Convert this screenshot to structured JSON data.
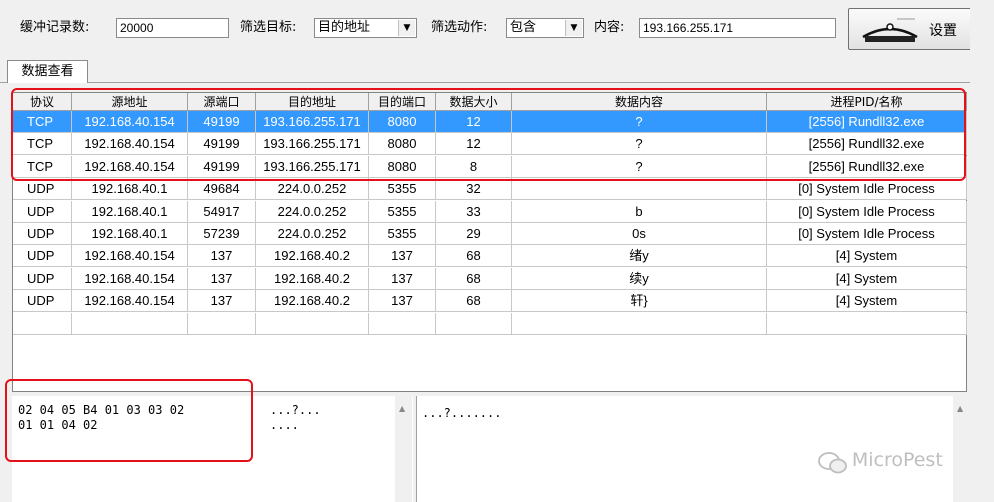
{
  "toolbar": {
    "buffer_label": "缓冲记录数:",
    "buffer_value": "20000",
    "target_label": "筛选目标:",
    "target_value": "目的地址",
    "action_label": "筛选动作:",
    "action_value": "包含",
    "content_label": "内容:",
    "content_value": "193.166.255.171",
    "settings_label": "设置"
  },
  "tabs": [
    "数据查看"
  ],
  "table": {
    "columns": [
      "协议",
      "源地址",
      "源端口",
      "目的地址",
      "目的端口",
      "数据大小",
      "数据内容",
      "进程PID/名称"
    ],
    "rows": [
      [
        "TCP",
        "192.168.40.154",
        "49199",
        "193.166.255.171",
        "8080",
        "12",
        "?",
        "[2556] Rundll32.exe"
      ],
      [
        "TCP",
        "192.168.40.154",
        "49199",
        "193.166.255.171",
        "8080",
        "12",
        "?",
        "[2556] Rundll32.exe"
      ],
      [
        "TCP",
        "192.168.40.154",
        "49199",
        "193.166.255.171",
        "8080",
        "8",
        "?",
        "[2556] Rundll32.exe"
      ],
      [
        "UDP",
        "192.168.40.1",
        "49684",
        "224.0.0.252",
        "5355",
        "32",
        "",
        "[0] System Idle Process"
      ],
      [
        "UDP",
        "192.168.40.1",
        "54917",
        "224.0.0.252",
        "5355",
        "33",
        "b",
        "[0] System Idle Process"
      ],
      [
        "UDP",
        "192.168.40.1",
        "57239",
        "224.0.0.252",
        "5355",
        "29",
        "0s",
        "[0] System Idle Process"
      ],
      [
        "UDP",
        "192.168.40.154",
        "137",
        "192.168.40.2",
        "137",
        "68",
        "绪y",
        "[4] System"
      ],
      [
        "UDP",
        "192.168.40.154",
        "137",
        "192.168.40.2",
        "137",
        "68",
        "续y",
        "[4] System"
      ],
      [
        "UDP",
        "192.168.40.154",
        "137",
        "192.168.40.2",
        "137",
        "68",
        "轩}",
        "[4] System"
      ],
      [
        "",
        "",
        "",
        "",
        "",
        "",
        "",
        ""
      ]
    ],
    "selected_row": 0
  },
  "hex": {
    "bytes": "02 04 05 B4 01 03 03 02\n01 01 04 02",
    "ascii": "...?...\n....",
    "text": "...?......."
  },
  "watermark": "MicroPest"
}
